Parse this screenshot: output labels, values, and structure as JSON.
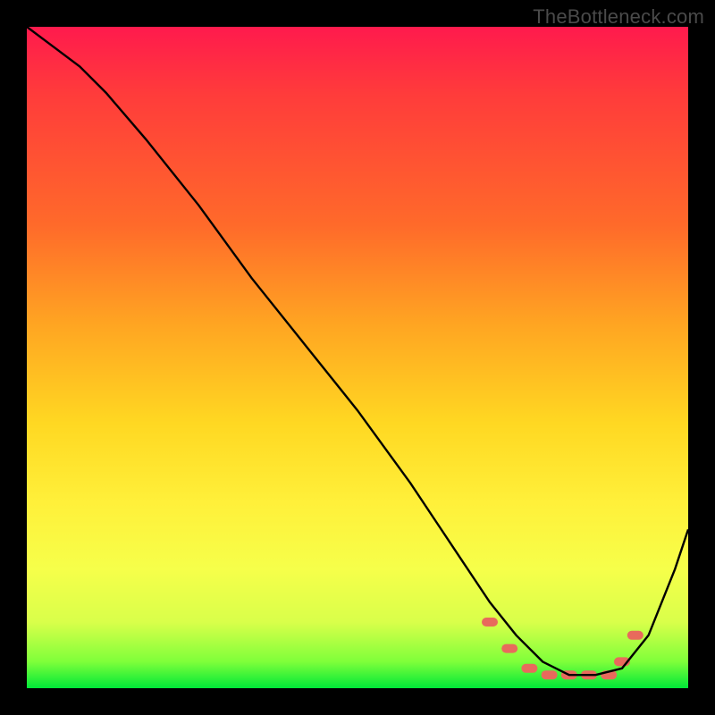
{
  "watermark": "TheBottleneck.com",
  "chart_data": {
    "type": "line",
    "title": "",
    "xlabel": "",
    "ylabel": "",
    "xlim": [
      0,
      100
    ],
    "ylim": [
      0,
      100
    ],
    "series": [
      {
        "name": "bottleneck-curve",
        "x": [
          0,
          4,
          8,
          12,
          18,
          26,
          34,
          42,
          50,
          58,
          62,
          66,
          70,
          74,
          78,
          82,
          86,
          90,
          94,
          98,
          100
        ],
        "y": [
          100,
          97,
          94,
          90,
          83,
          73,
          62,
          52,
          42,
          31,
          25,
          19,
          13,
          8,
          4,
          2,
          2,
          3,
          8,
          18,
          24
        ]
      }
    ],
    "highlight_band": {
      "x_start": 70,
      "x_end": 92,
      "y": 3
    },
    "highlight_dots": {
      "x": [
        70,
        73,
        76,
        79,
        82,
        85,
        88,
        90,
        92
      ],
      "y": [
        10,
        6,
        3,
        2,
        2,
        2,
        2,
        4,
        8
      ]
    },
    "colors": {
      "curve": "#000000",
      "highlight": "#e86a5c",
      "gradient_top": "#ff1a4d",
      "gradient_bottom": "#00e838"
    }
  }
}
